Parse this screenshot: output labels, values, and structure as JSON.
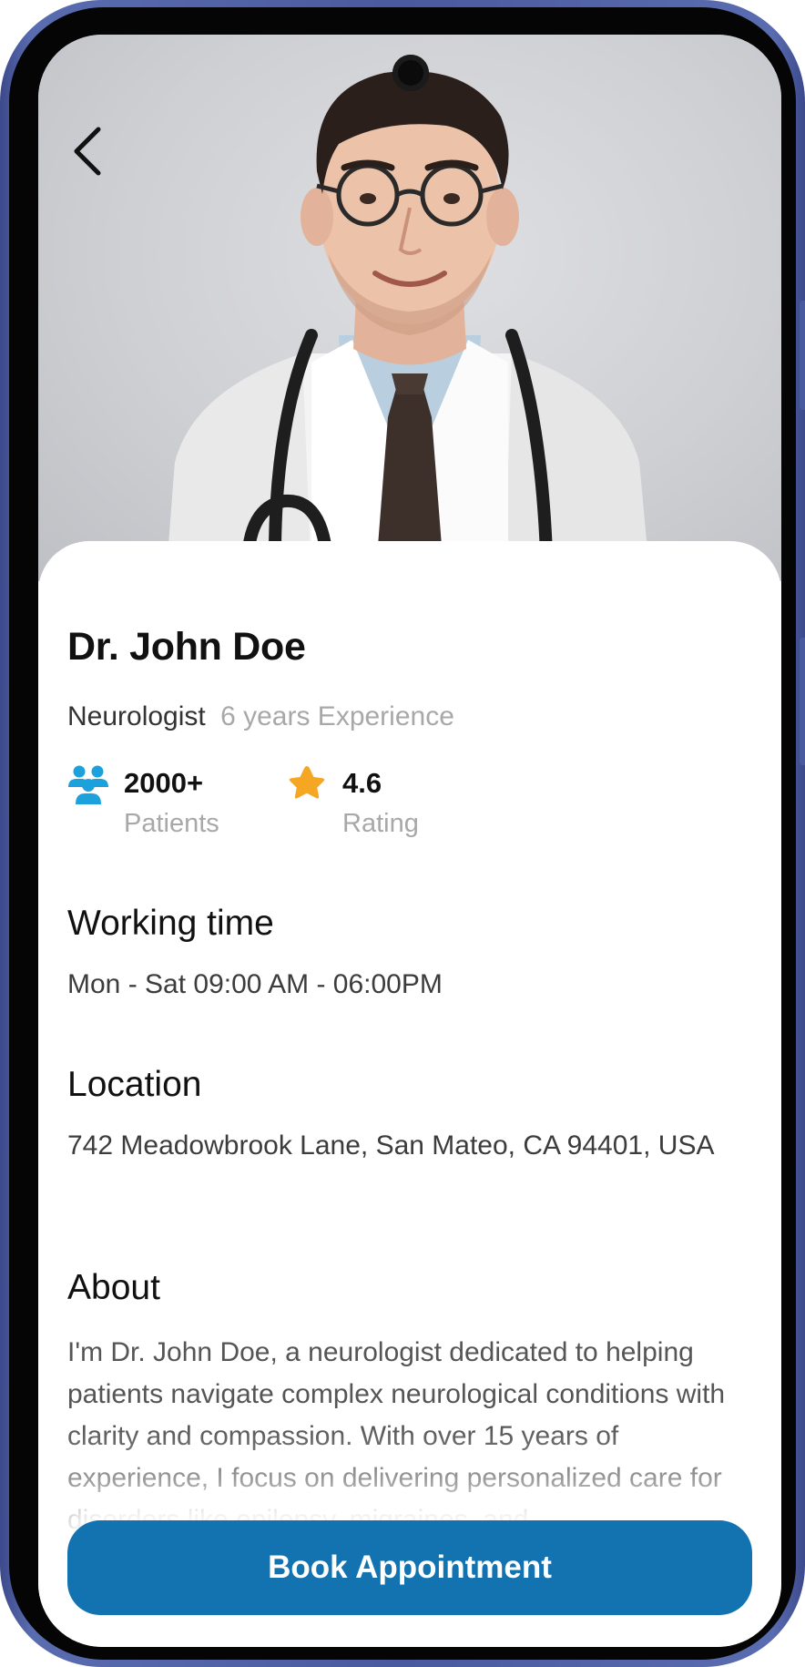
{
  "colors": {
    "accent": "#1273b0",
    "patients_icon": "#1da1dc",
    "rating_icon": "#f5a623",
    "muted_text": "#a8a8a8"
  },
  "header": {
    "back_icon": "chevron-left-icon"
  },
  "doctor": {
    "name": "Dr. John Doe",
    "specialty": "Neurologist",
    "experience": "6 years Experience"
  },
  "stats": {
    "patients": {
      "icon": "people-icon",
      "value": "2000+",
      "label": "Patients"
    },
    "rating": {
      "icon": "star-icon",
      "value": "4.6",
      "label": "Rating"
    }
  },
  "working_time": {
    "title": "Working time",
    "value": "Mon - Sat 09:00 AM - 06:00PM"
  },
  "location": {
    "title": "Location",
    "value": "742 Meadowbrook Lane, San Mateo, CA 94401, USA"
  },
  "about": {
    "title": "About",
    "text": "I'm Dr. John Doe, a neurologist dedicated to helping patients navigate complex neurological conditions with clarity and compassion. With over 15 years of experience, I focus on delivering personalized care for disorders like epilepsy, migraines, and"
  },
  "cta": {
    "label": "Book Appointment"
  }
}
